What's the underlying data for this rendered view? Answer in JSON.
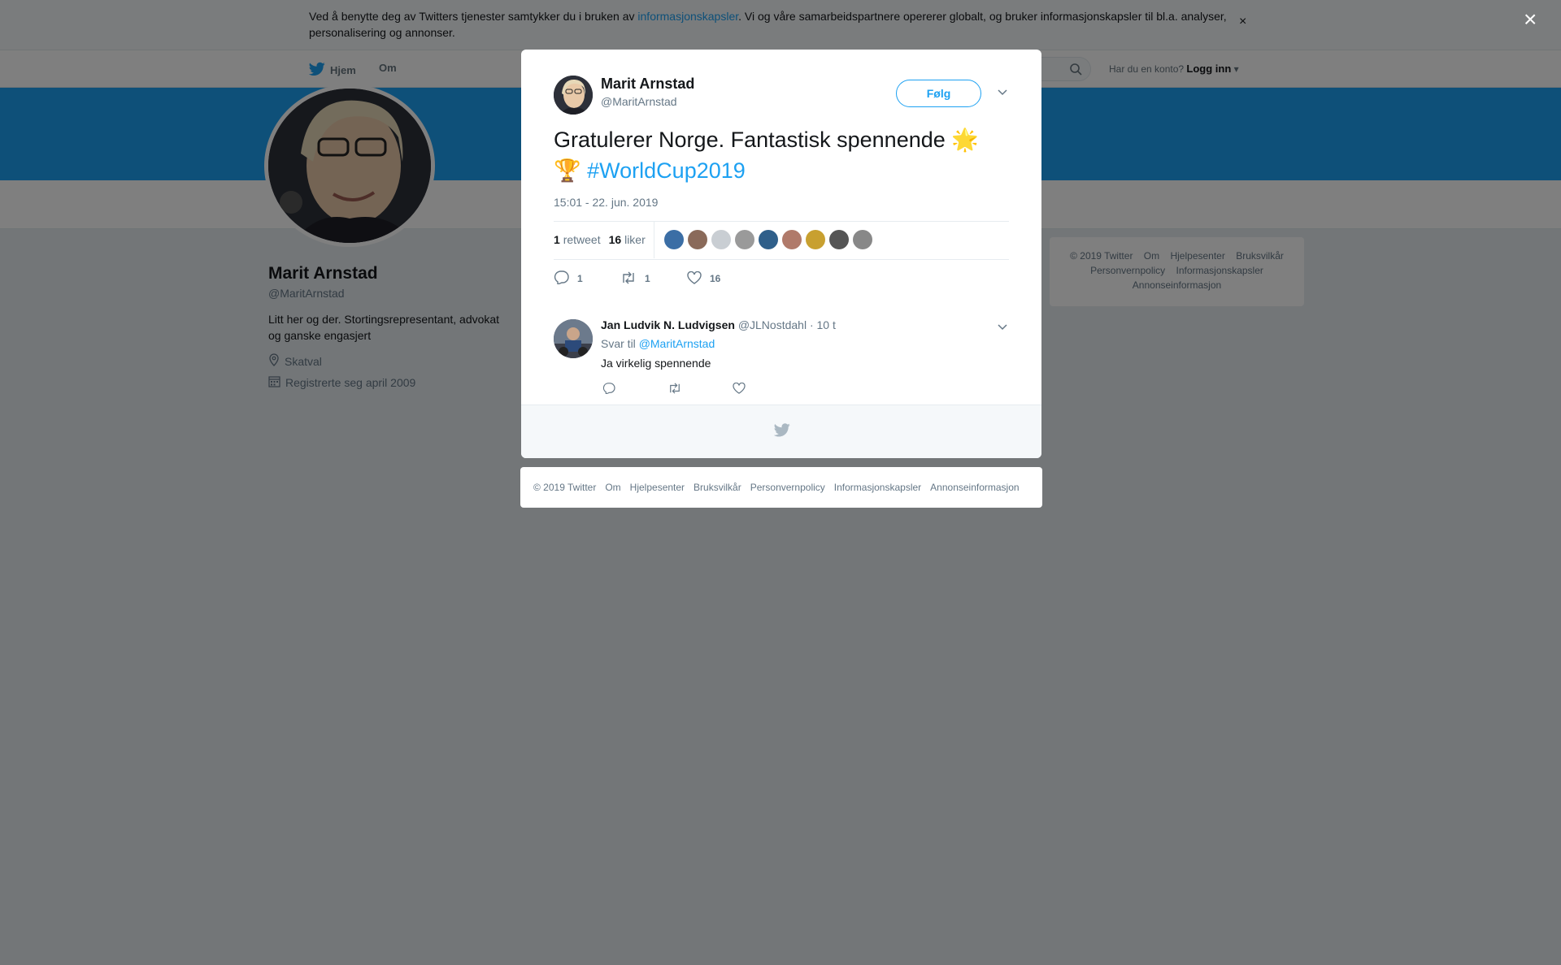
{
  "cookie_bar": {
    "text_before": "Ved å benytte deg av Twitters tjenester samtykker du i bruken av ",
    "link": "informasjonskapsler",
    "text_after": ". Vi og våre samarbeidspartnere opererer globalt, og bruker informasjonskapsler til bl.a. analyser, personalisering og annonser.",
    "close": "×"
  },
  "nav": {
    "home": "Hjem",
    "about": "Om",
    "have_account": "Har du en konto?",
    "login": "Logg inn"
  },
  "profile": {
    "name": "Marit Arnstad",
    "handle": "@MaritArnstad",
    "bio": "Litt her og der. Stortingsrepresentant, advokat og ganske engasjert",
    "location": "Skatval",
    "joined": "Registrerte seg april 2009"
  },
  "side_footer": {
    "items": [
      "© 2019 Twitter",
      "Om",
      "Hjelpesenter",
      "Bruksvilkår",
      "Personvernpolicy",
      "Informasjonskapsler",
      "Annonseinformasjon"
    ]
  },
  "overlay_close": "×",
  "tweet": {
    "author_name": "Marit Arnstad",
    "author_handle": "@MaritArnstad",
    "follow_label": "Følg",
    "text": "Gratulerer Norge. Fantastisk spennende",
    "emoji_star": "🌟",
    "emoji_trophy": "🏆",
    "hashtag": "#WorldCup2019",
    "timestamp": "15:01 - 22. jun. 2019",
    "retweet_count": "1",
    "retweet_label": "retweet",
    "like_count": "16",
    "like_label": "liker",
    "action_reply_count": "1",
    "action_retweet_count": "1",
    "action_like_count": "16",
    "liker_colors": [
      "#3b6ea5",
      "#8a6a5a",
      "#c9ced3",
      "#9a9a9a",
      "#2f5f8a",
      "#b07a6a",
      "#c8a030",
      "#555555",
      "#888888"
    ]
  },
  "reply": {
    "name": "Jan Ludvik N. Ludvigsen",
    "handle": "@JLNostdahl",
    "time": "· 10 t",
    "reply_to_prefix": "Svar til",
    "reply_to_handle": "@MaritArnstad",
    "text": "Ja virkelig spennende"
  },
  "bottom_footer": {
    "items": [
      "© 2019 Twitter",
      "Om",
      "Hjelpesenter",
      "Bruksvilkår",
      "Personvernpolicy",
      "Informasjonskapsler",
      "Annonseinformasjon"
    ]
  },
  "colors": {
    "accent": "#1da1f2",
    "overlay": "rgba(0,0,0,0.5)"
  }
}
